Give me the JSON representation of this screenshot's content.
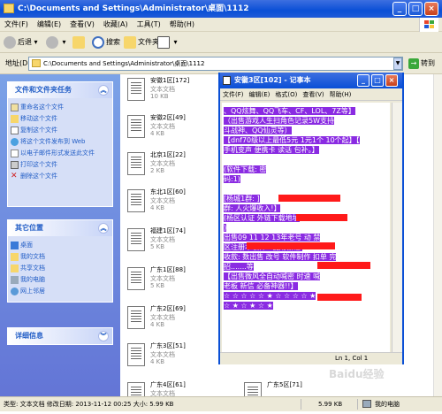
{
  "explorer": {
    "title": "C:\\Documents and Settings\\Administrator\\桌面\\1112",
    "menu": [
      "文件(F)",
      "编辑(E)",
      "查看(V)",
      "收藏(A)",
      "工具(T)",
      "帮助(H)"
    ],
    "toolbar": {
      "back": "后退",
      "search": "搜索",
      "folders": "文件夹"
    },
    "address": {
      "label": "地址(D)",
      "value": "C:\\Documents and Settings\\Administrator\\桌面\\1112",
      "go": "转到"
    },
    "file_tasks": {
      "title": "文件和文件夹任务",
      "items": [
        "重命名这个文件",
        "移动这个文件",
        "复制这个文件",
        "将这个文件发布到 Web",
        "以电子邮件形式发送此文件",
        "打印这个文件",
        "删除这个文件"
      ]
    },
    "other_places": {
      "title": "其它位置",
      "items": [
        "桌面",
        "我的文档",
        "共享文档",
        "我的电脑",
        "网上邻居"
      ]
    },
    "details": {
      "title": "详细信息"
    },
    "files": [
      {
        "name": "安徽1区[172]",
        "type": "文本文档",
        "size": "10 KB"
      },
      {
        "name": "安徽2区[49]",
        "type": "文本文档",
        "size": "4 KB"
      },
      {
        "name": "北京1区[22]",
        "type": "文本文档",
        "size": "2 KB"
      },
      {
        "name": "东北1区[60]",
        "type": "文本文档",
        "size": "4 KB"
      },
      {
        "name": "福建1区[74]",
        "type": "文本文档",
        "size": "5 KB"
      },
      {
        "name": "广东1区[88]",
        "type": "文本文档",
        "size": "5 KB"
      },
      {
        "name": "广东2区[69]",
        "type": "文本文档",
        "size": "4 KB"
      },
      {
        "name": "广东3区[51]",
        "type": "文本文档",
        "size": "4 KB"
      },
      {
        "name": "广东4区[61]",
        "type": "文本文档",
        "size": ""
      },
      {
        "name": "广东5区[71]",
        "type": "",
        "size": ""
      }
    ],
    "status": {
      "info": "类型: 文本文档 修改日期: 2013-11-12 00:25 大小: 5.99 KB",
      "size": "5.99 KB",
      "location": "我的电脑"
    }
  },
  "notepad": {
    "title": "安徽3区[102] - 记事本",
    "menu": [
      "文件(F)",
      "编辑(E)",
      "格式(O)",
      "查看(V)",
      "帮助(H)"
    ],
    "lines": [
      "、QQ炫舞、QQ飞车、CF、LOL、7Z等】",
      "（出售游戏人生扫角色记录5W支持",
      "斗战神、QQ仙灵等）",
      "【dnf70级以上最低5元 1元1个 10个起】【",
      "手机变声 便携卡 读话 包补。】",
      "",
      "(软件下载:                     密",
      "码:1)",
      "",
      "[杨城1群:                 ]",
      "群:                 人火爆收入!】",
      "(杨区认证                   外链下载地址",
      "                        )",
      "出售09 11 12 13年老号            动 禁",
      "区注册本软件+使用教程:",
      "收款:      数出售 改号 软件制作 扣单 完",
      "招.......等",
      "【出售微风全自动喊密           时速     喊",
      "老板 新信 必备神器!!】",
      "☆ ☆ ☆ ☆ ☆ ★ ☆ ☆ ☆ ☆ ★",
      "☆ ★ ☆ ★ ☆ ★"
    ],
    "status": "Ln 1, Col 1"
  },
  "watermark": "Baidu经验"
}
